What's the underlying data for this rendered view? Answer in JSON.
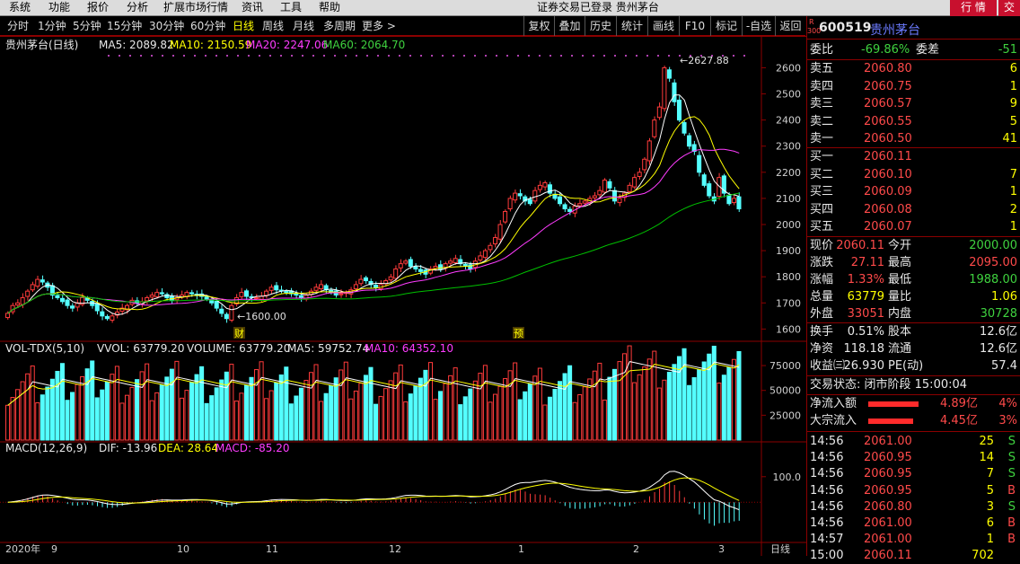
{
  "menu": {
    "items": [
      "系统",
      "功能",
      "报价",
      "分析",
      "扩展市场行情",
      "资讯",
      "工具",
      "帮助"
    ],
    "center": "证券交易已登录  贵州茅台",
    "right_buttons": [
      "行 情",
      "交"
    ]
  },
  "tabs": {
    "periods": [
      "分时",
      "1分钟",
      "5分钟",
      "15分钟",
      "30分钟",
      "60分钟",
      "日线",
      "周线",
      "月线",
      "多周期",
      "更多 >"
    ],
    "active": "日线",
    "right": [
      "复权",
      "叠加",
      "历史",
      "统计",
      "画线",
      "F10",
      "标记",
      "-自选",
      "返回"
    ]
  },
  "main": {
    "name": "贵州茅台(日线)",
    "ma5": "MA5: 2089.82",
    "ma10": "MA10: 2150.59",
    "ma20": "MA20: 2247.06",
    "ma60": "MA60: 2064.70",
    "high_label": "2627.88",
    "low_label": "1600.00",
    "marks": [
      "财",
      "预"
    ]
  },
  "volume": {
    "title": "VOL-TDX(5,10)",
    "vvol": "VVOL: 63779.20",
    "volume": "VOLUME: 63779.20",
    "ma5": "MA5: 59752.74",
    "ma10": "MA10: 64352.10"
  },
  "macd": {
    "title": "MACD(12,26,9)",
    "dif": "DIF: -13.96",
    "dea": "DEA: 28.64",
    "macd": "MACD: -85.20"
  },
  "axis": {
    "x_labels": [
      "2020年",
      "9",
      "10",
      "11",
      "12",
      "1",
      "2",
      "3"
    ],
    "price_ticks": [
      "2600",
      "2500",
      "2400",
      "2300",
      "2200",
      "2100",
      "2000",
      "1900",
      "1800",
      "1700",
      "1600"
    ],
    "vol_ticks": [
      "75000",
      "50000",
      "25000"
    ],
    "macd_ticks": [
      "100.0"
    ],
    "period_label": "日线"
  },
  "quote": {
    "code": "600519",
    "name": "贵州茅台",
    "badge_top": "R",
    "badge_bottom": "300",
    "weibi_label": "委比",
    "weibi": "-69.86%",
    "weicha_label": "委差",
    "weicha": "-51",
    "asks": [
      {
        "label": "卖五",
        "price": "2060.80",
        "vol": "6"
      },
      {
        "label": "卖四",
        "price": "2060.75",
        "vol": "1"
      },
      {
        "label": "卖三",
        "price": "2060.57",
        "vol": "9"
      },
      {
        "label": "卖二",
        "price": "2060.55",
        "vol": "5"
      },
      {
        "label": "卖一",
        "price": "2060.50",
        "vol": "41"
      }
    ],
    "bids": [
      {
        "label": "买一",
        "price": "2060.11",
        "vol": ""
      },
      {
        "label": "买二",
        "price": "2060.10",
        "vol": "7"
      },
      {
        "label": "买三",
        "price": "2060.09",
        "vol": "1"
      },
      {
        "label": "买四",
        "price": "2060.08",
        "vol": "2"
      },
      {
        "label": "买五",
        "price": "2060.07",
        "vol": "1"
      }
    ],
    "stats": [
      {
        "l1": "现价",
        "v1": "2060.11",
        "l2": "今开",
        "v2": "2000.00"
      },
      {
        "l1": "涨跌",
        "v1": "27.11",
        "l2": "最高",
        "v2": "2095.00"
      },
      {
        "l1": "涨幅",
        "v1": "1.33%",
        "l2": "最低",
        "v2": "1988.00"
      },
      {
        "l1": "总量",
        "v1": "63779",
        "l2": "量比",
        "v2": "1.06"
      },
      {
        "l1": "外盘",
        "v1": "33051",
        "l2": "内盘",
        "v2": "30728"
      }
    ],
    "stats2": [
      {
        "l1": "换手",
        "v1": "0.51%",
        "l2": "股本",
        "v2": "12.6亿"
      },
      {
        "l1": "净资",
        "v1": "118.18",
        "l2": "流通",
        "v2": "12.6亿"
      },
      {
        "l1": "收益㈢",
        "v1": "26.930",
        "l2": "PE(动)",
        "v2": "57.4"
      }
    ],
    "status": "交易状态: 闭市阶段 15:00:04",
    "flow": [
      {
        "label": "净流入额",
        "amount": "4.89亿",
        "pct": "4%"
      },
      {
        "label": "大宗流入",
        "amount": "4.45亿",
        "pct": "3%"
      }
    ],
    "ticks": [
      {
        "t": "14:56",
        "p": "2061.00",
        "v": "25",
        "s": "S"
      },
      {
        "t": "14:56",
        "p": "2060.95",
        "v": "14",
        "s": "S"
      },
      {
        "t": "14:56",
        "p": "2060.95",
        "v": "7",
        "s": "S"
      },
      {
        "t": "14:56",
        "p": "2060.95",
        "v": "5",
        "s": "B"
      },
      {
        "t": "14:56",
        "p": "2060.80",
        "v": "3",
        "s": "S"
      },
      {
        "t": "14:56",
        "p": "2061.00",
        "v": "6",
        "s": "B"
      },
      {
        "t": "14:57",
        "p": "2061.00",
        "v": "1",
        "s": "B"
      },
      {
        "t": "15:00",
        "p": "2060.11",
        "v": "702",
        "s": ""
      }
    ]
  },
  "chart_data": {
    "type": "candlestick",
    "series_hint": "daily candles, Aug 2020 - Mar 2021",
    "ma_lines": [
      "MA5",
      "MA10",
      "MA20",
      "MA60"
    ],
    "colors": {
      "up": "#ff3b3b",
      "down": "#54ffff",
      "ma5": "#ffffff",
      "ma10": "#ffff00",
      "ma20": "#ff3cff",
      "ma60": "#00c000"
    },
    "ylim": [
      1560,
      2660
    ],
    "closes": [
      1660,
      1690,
      1700,
      1720,
      1745,
      1770,
      1790,
      1780,
      1760,
      1730,
      1720,
      1705,
      1690,
      1680,
      1700,
      1720,
      1710,
      1690,
      1670,
      1650,
      1640,
      1650,
      1665,
      1680,
      1690,
      1710,
      1700,
      1705,
      1720,
      1730,
      1740,
      1735,
      1720,
      1710,
      1720,
      1730,
      1740,
      1735,
      1728,
      1725,
      1715,
      1700,
      1680,
      1660,
      1640,
      1690,
      1720,
      1740,
      1725,
      1720,
      1720,
      1725,
      1745,
      1760,
      1750,
      1745,
      1740,
      1735,
      1730,
      1720,
      1730,
      1745,
      1760,
      1770,
      1750,
      1740,
      1730,
      1735,
      1740,
      1750,
      1770,
      1790,
      1785,
      1770,
      1760,
      1770,
      1785,
      1800,
      1830,
      1850,
      1860,
      1840,
      1830,
      1820,
      1810,
      1830,
      1840,
      1830,
      1850,
      1860,
      1870,
      1850,
      1840,
      1830,
      1860,
      1880,
      1900,
      1920,
      1950,
      2000,
      2050,
      2100,
      2120,
      2110,
      2090,
      2080,
      2130,
      2150,
      2160,
      2120,
      2100,
      2080,
      2060,
      2050,
      2070,
      2080,
      2090,
      2100,
      2110,
      2130,
      2170,
      2140,
      2090,
      2100,
      2120,
      2150,
      2180,
      2200,
      2250,
      2320,
      2400,
      2450,
      2600,
      2560,
      2470,
      2400,
      2350,
      2300,
      2280,
      2200,
      2150,
      2110,
      2090,
      2180,
      2120,
      2080,
      2100,
      2060
    ]
  }
}
